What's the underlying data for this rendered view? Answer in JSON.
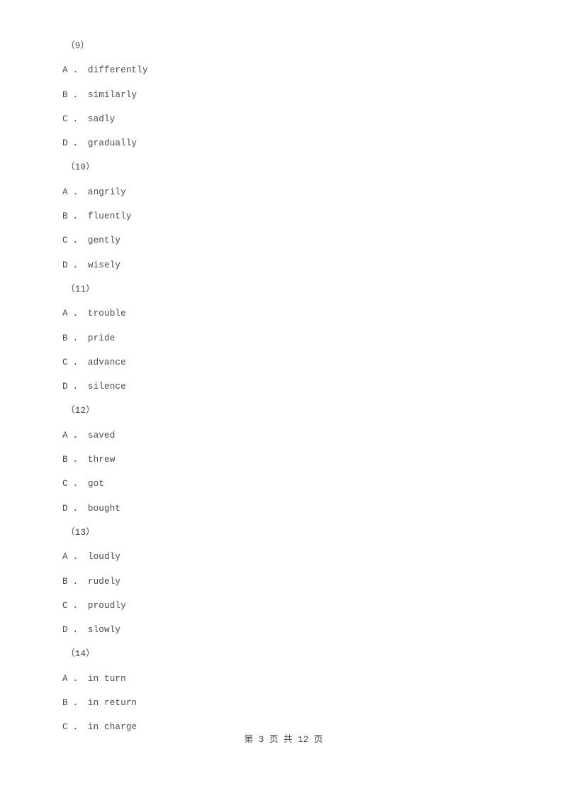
{
  "document": {
    "page_number": "3",
    "total_pages": "12",
    "footer_text": "第 3 页 共 12 页"
  },
  "lines": [
    {
      "type": "question",
      "text": "（9）"
    },
    {
      "type": "option",
      "text": "A ． differently"
    },
    {
      "type": "option",
      "text": "B ． similarly"
    },
    {
      "type": "option",
      "text": "C ． sadly"
    },
    {
      "type": "option",
      "text": "D ． gradually"
    },
    {
      "type": "question",
      "text": "（10）"
    },
    {
      "type": "option",
      "text": "A ． angrily"
    },
    {
      "type": "option",
      "text": "B ． fluently"
    },
    {
      "type": "option",
      "text": "C ． gently"
    },
    {
      "type": "option",
      "text": "D ． wisely"
    },
    {
      "type": "question",
      "text": "（11）"
    },
    {
      "type": "option",
      "text": "A ． trouble"
    },
    {
      "type": "option",
      "text": "B ． pride"
    },
    {
      "type": "option",
      "text": "C ． advance"
    },
    {
      "type": "option",
      "text": "D ． silence"
    },
    {
      "type": "question",
      "text": "（12）"
    },
    {
      "type": "option",
      "text": "A ． saved"
    },
    {
      "type": "option",
      "text": "B ． threw"
    },
    {
      "type": "option",
      "text": "C ． got"
    },
    {
      "type": "option",
      "text": "D ． bought"
    },
    {
      "type": "question",
      "text": "（13）"
    },
    {
      "type": "option",
      "text": "A ． loudly"
    },
    {
      "type": "option",
      "text": "B ． rudely"
    },
    {
      "type": "option",
      "text": "C ． proudly"
    },
    {
      "type": "option",
      "text": "D ． slowly"
    },
    {
      "type": "question",
      "text": "（14）"
    },
    {
      "type": "option",
      "text": "A ． in turn"
    },
    {
      "type": "option",
      "text": "B ． in return"
    },
    {
      "type": "option",
      "text": "C ． in charge"
    }
  ]
}
